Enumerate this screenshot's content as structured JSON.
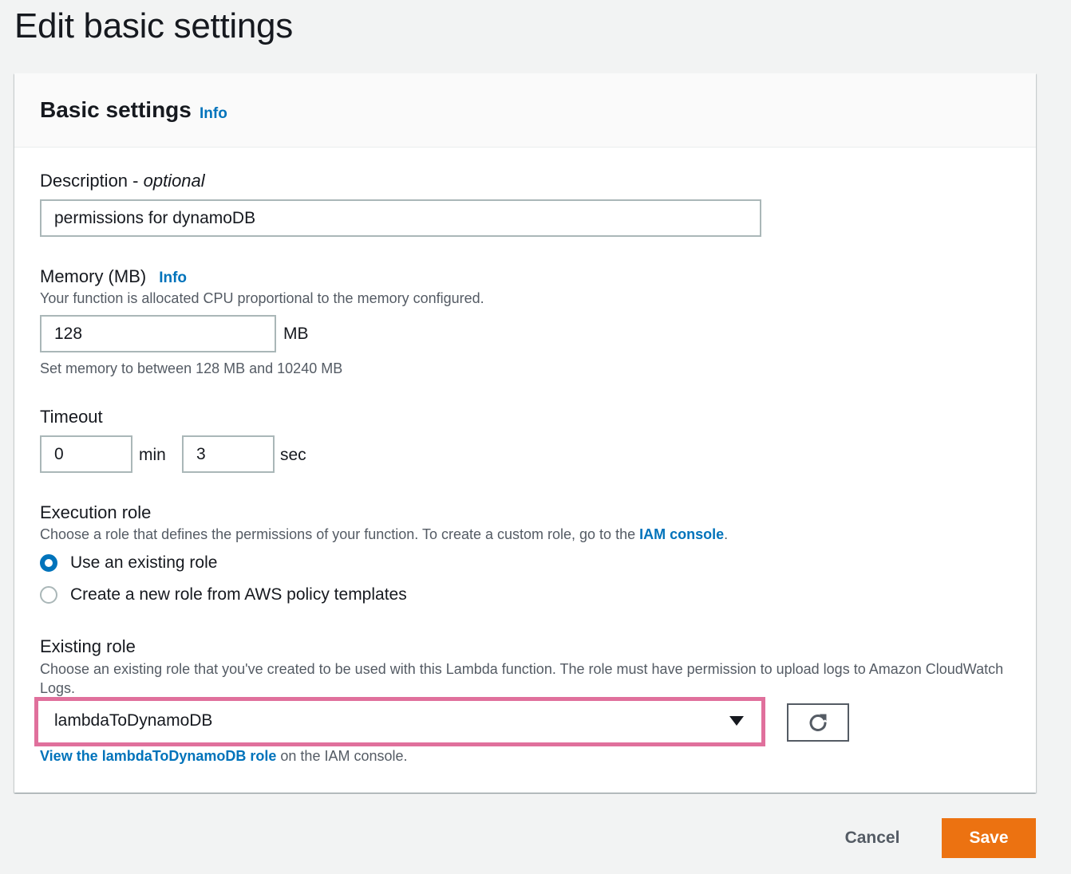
{
  "page": {
    "title": "Edit basic settings"
  },
  "panel": {
    "title": "Basic settings",
    "info": "Info"
  },
  "description": {
    "label": "Description - ",
    "label_optional": "optional",
    "value": "permissions for dynamoDB"
  },
  "memory": {
    "label": "Memory (MB)",
    "info": "Info",
    "help": "Your function is allocated CPU proportional to the memory configured.",
    "value": "128",
    "unit": "MB",
    "constraint": "Set memory to between 128 MB and 10240 MB"
  },
  "timeout": {
    "label": "Timeout",
    "min_value": "0",
    "min_unit": "min",
    "sec_value": "3",
    "sec_unit": "sec"
  },
  "execution_role": {
    "label": "Execution role",
    "help_prefix": "Choose a role that defines the permissions of your function. To create a custom role, go to the ",
    "help_link": "IAM console",
    "help_suffix": ".",
    "options": [
      {
        "label": "Use an existing role",
        "checked": true
      },
      {
        "label": "Create a new role from AWS policy templates",
        "checked": false
      }
    ]
  },
  "existing_role": {
    "label": "Existing role",
    "help": "Choose an existing role that you've created to be used with this Lambda function. The role must have permission to upload logs to Amazon CloudWatch Logs.",
    "selected": "lambdaToDynamoDB",
    "view_link": "View the lambdaToDynamoDB role",
    "view_suffix": " on the IAM console.",
    "refresh_icon": "refresh-icon",
    "highlight_color": "#e0709c"
  },
  "footer": {
    "cancel": "Cancel",
    "save": "Save"
  },
  "colors": {
    "link": "#0073bb",
    "primary": "#ec7211",
    "background": "#f2f3f3"
  }
}
